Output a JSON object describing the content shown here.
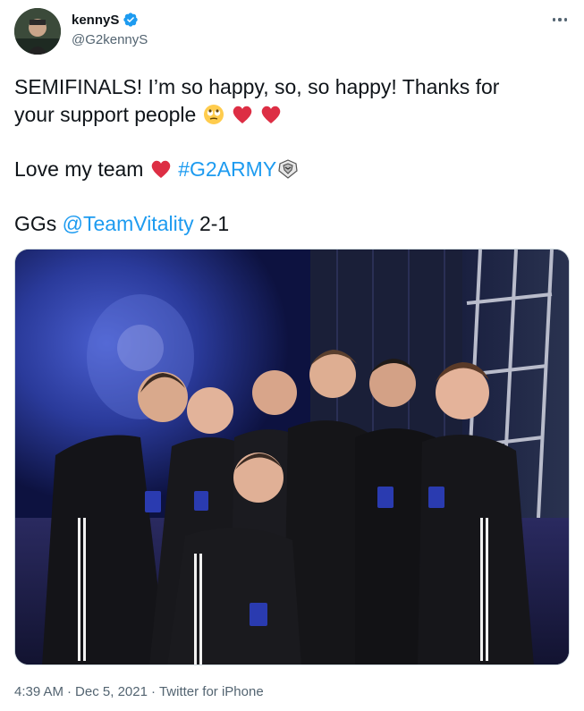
{
  "author": {
    "display_name": "kennyS",
    "handle": "@G2kennyS",
    "verified": true,
    "avatar_icon": "profile-photo"
  },
  "tweet": {
    "line1": "SEMIFINALS! I’m so happy, so, so happy! Thanks for",
    "line2_text": "your support people",
    "line3_text": "Love my team",
    "line3_hashtag": "#G2ARMY",
    "line4_prefix": "GGs",
    "line4_mention": "@TeamVitality",
    "line4_suffix": "2-1"
  },
  "media": {
    "icon": "team-photo"
  },
  "meta": {
    "time": "4:39 AM",
    "separator1": "·",
    "date": "Dec 5, 2021",
    "separator2": "·",
    "source": "Twitter for iPhone"
  },
  "colors": {
    "link": "#1d9bf0",
    "secondary_text": "#536471",
    "verified": "#1d9bf0",
    "heart": "#dd2e44"
  }
}
